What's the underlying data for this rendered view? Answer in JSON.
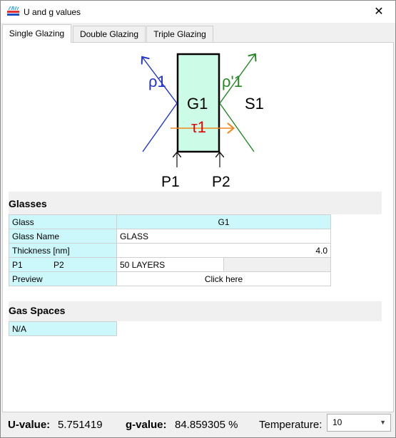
{
  "window": {
    "title": "U and g values",
    "close_glyph": "✕"
  },
  "tabs": [
    {
      "label": "Single Glazing",
      "active": true
    },
    {
      "label": "Double Glazing",
      "active": false
    },
    {
      "label": "Triple Glazing",
      "active": false
    }
  ],
  "diagram": {
    "rho1": "ρ1",
    "rho1_prime": "ρ'1",
    "glass": "G1",
    "s1": "S1",
    "tau1": "τ1",
    "p1": "P1",
    "p2": "P2",
    "colors": {
      "glass_fill": "#ccfbe8",
      "rho1": "#2233cc",
      "rho1_prime": "#228822",
      "tau1_arrow": "#f08a20",
      "tau1_text": "#dd0000"
    }
  },
  "glasses": {
    "title": "Glasses",
    "rows": {
      "glass": {
        "label": "Glass",
        "value": "G1"
      },
      "glass_name": {
        "label": "Glass Name",
        "value": "GLASS"
      },
      "thickness": {
        "label": "Thickness [nm]",
        "value": "4.0"
      },
      "p": {
        "label_p1": "P1",
        "label_p2": "P2",
        "value": "50 LAYERS",
        "extra": ""
      },
      "preview": {
        "label": "Preview",
        "value": "Click here"
      }
    }
  },
  "gas_spaces": {
    "title": "Gas Spaces",
    "rows": [
      "N/A"
    ]
  },
  "results": {
    "u_label": "U-value:",
    "u_value": "5.751419",
    "g_label": "g-value:",
    "g_value": "84.859305 %",
    "temp_label": "Temperature:",
    "temp_value": "10"
  }
}
